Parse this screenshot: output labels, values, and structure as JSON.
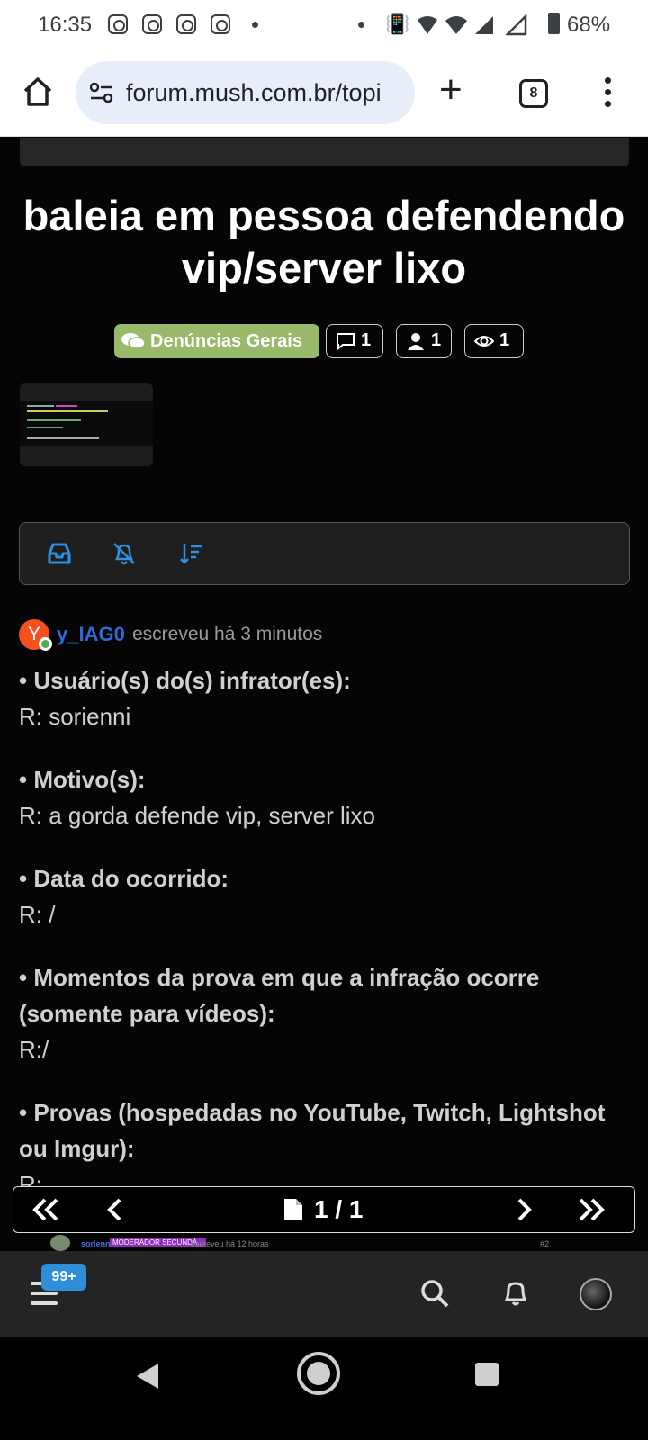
{
  "status_bar": {
    "time": "16:35",
    "battery_percent": "68%",
    "notification_icons": [
      "instagram-icon",
      "instagram-icon",
      "instagram-icon",
      "instagram-icon"
    ]
  },
  "browser": {
    "url": "forum.mush.com.br/topi",
    "tab_count": "8"
  },
  "topic": {
    "title": "baleia em pessoa defendendo vip/server lixo",
    "category": "Denúncias Gerais",
    "category_color": "#98b86a",
    "posts_count": "1",
    "posters_count": "1",
    "views_count": "1"
  },
  "post": {
    "avatar_letter": "Y",
    "author": "y_IAG0",
    "meta": "escreveu há 3 minutos",
    "fields": [
      {
        "question": "• Usuário(s) do(s) infrator(es):",
        "answer": "R: sorienni"
      },
      {
        "question": "• Motivo(s):",
        "answer": "R: a gorda defende vip, server lixo"
      },
      {
        "question": "• Data do ocorrido:",
        "answer": "R: /"
      },
      {
        "question": "• Momentos da prova em que a infração ocorre (somente para vídeos):",
        "answer": "R:/"
      },
      {
        "question": "• Provas (hospedadas no YouTube, Twitch, Lightshot ou Imgur):",
        "answer": "R:"
      }
    ]
  },
  "pager": {
    "label": "1 / 1"
  },
  "next_post_preview": {
    "author": "sorienni",
    "badge": "MODERADOR SECUNDÁ...",
    "meta": "escreveu há 12 horas",
    "index": "#2"
  },
  "bottom_bar": {
    "notification_count": "99+"
  }
}
